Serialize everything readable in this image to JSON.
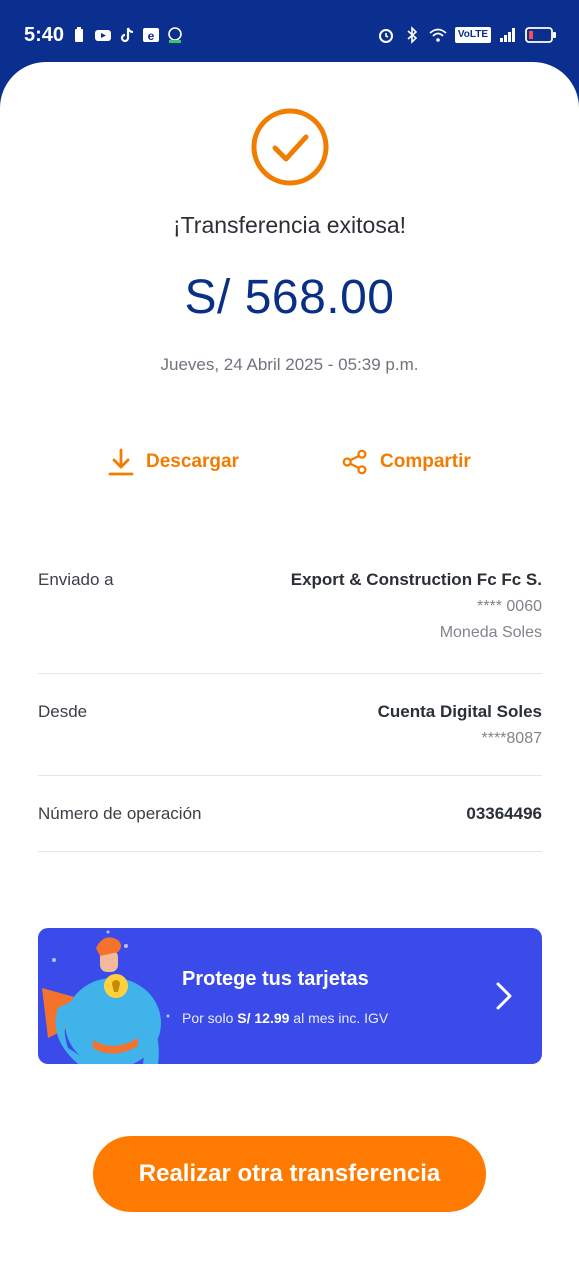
{
  "status_bar": {
    "time": "5:40",
    "left_icons": [
      "battery-saver-icon",
      "youtube-icon",
      "tiktok-icon",
      "e-app-icon",
      "app-icon"
    ],
    "right_icons": [
      "alarm-icon",
      "bluetooth-icon",
      "wifi-icon",
      "volte-badge",
      "signal-icon",
      "battery-icon"
    ],
    "volte_label": "VoLTE"
  },
  "receipt": {
    "title": "¡Transferencia exitosa!",
    "amount": "S/ 568.00",
    "datetime": "Jueves, 24 Abril 2025 - 05:39 p.m."
  },
  "actions": {
    "download_label": "Descargar",
    "share_label": "Compartir"
  },
  "details": {
    "sent_to": {
      "label": "Enviado a",
      "name": "Export & Construction Fc Fc S.",
      "account": "**** 0060",
      "currency": "Moneda Soles"
    },
    "from": {
      "label": "Desde",
      "account_name": "Cuenta Digital Soles",
      "account": "****8087"
    },
    "operation": {
      "label": "Número de operación",
      "number": "03364496"
    }
  },
  "promo": {
    "title": "Protege tus tarjetas",
    "subtitle_prefix": "Por solo ",
    "subtitle_price": "S/ 12.99",
    "subtitle_suffix": " al mes inc. IGV"
  },
  "cta": {
    "label": "Realizar otra transferencia"
  },
  "colors": {
    "brand_blue": "#0b2f8f",
    "accent_orange": "#ff7a00",
    "promo_blue": "#3b4bea"
  }
}
